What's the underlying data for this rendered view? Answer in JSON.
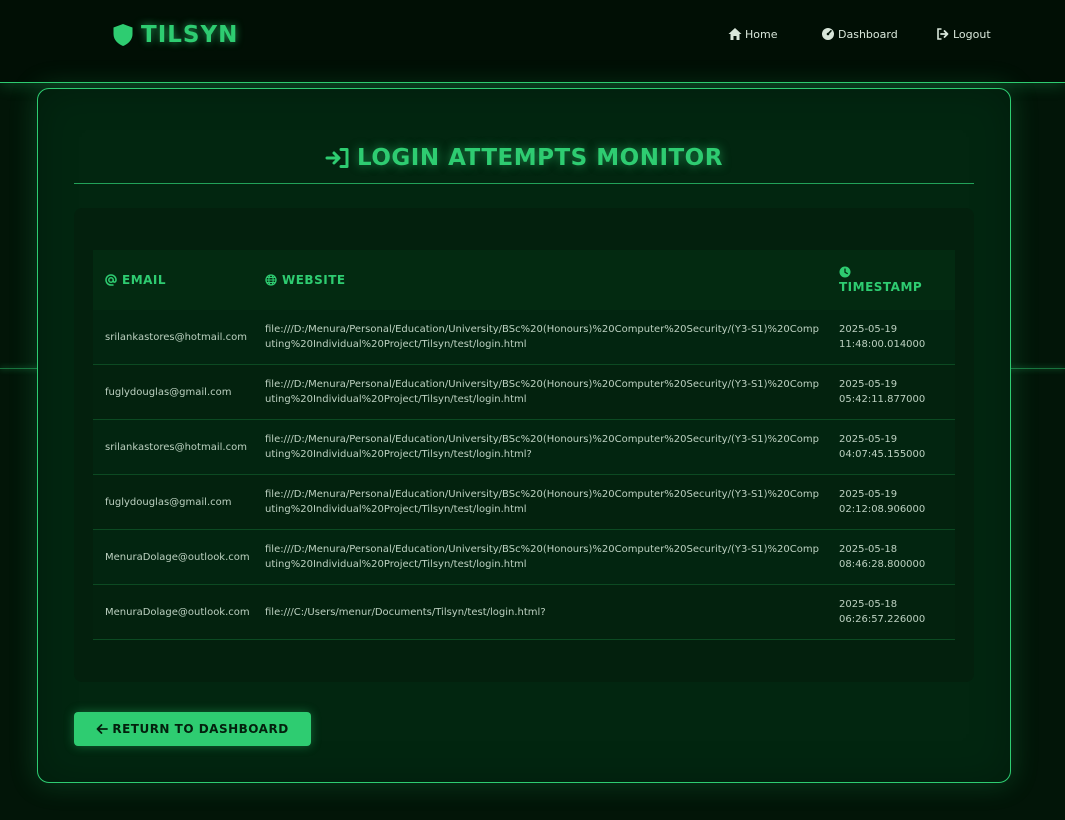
{
  "brand": {
    "name": "TILSYN",
    "icon": "shield-icon"
  },
  "nav": [
    {
      "label": "Home",
      "icon": "home-icon"
    },
    {
      "label": "Dashboard",
      "icon": "dashboard-gauge-icon"
    },
    {
      "label": "Logout",
      "icon": "logout-icon"
    }
  ],
  "page": {
    "title": "LOGIN ATTEMPTS MONITOR",
    "title_icon": "sign-in-icon"
  },
  "table": {
    "headers": {
      "email": "EMAIL",
      "website": "WEBSITE",
      "timestamp": "TIMESTAMP"
    },
    "rows": [
      {
        "email": "srilankastores@hotmail.com",
        "website": "file:///D:/Menura/Personal/Education/University/BSc%20(Honours)%20Computer%20Security/(Y3-S1)%20Computing%20Individual%20Project/Tilsyn/test/login.html",
        "date": "2025-05-19",
        "time": "11:48:00.014000"
      },
      {
        "email": "fuglydouglas@gmail.com",
        "website": "file:///D:/Menura/Personal/Education/University/BSc%20(Honours)%20Computer%20Security/(Y3-S1)%20Computing%20Individual%20Project/Tilsyn/test/login.html",
        "date": "2025-05-19",
        "time": "05:42:11.877000"
      },
      {
        "email": "srilankastores@hotmail.com",
        "website": "file:///D:/Menura/Personal/Education/University/BSc%20(Honours)%20Computer%20Security/(Y3-S1)%20Computing%20Individual%20Project/Tilsyn/test/login.html?",
        "date": "2025-05-19",
        "time": "04:07:45.155000"
      },
      {
        "email": "fuglydouglas@gmail.com",
        "website": "file:///D:/Menura/Personal/Education/University/BSc%20(Honours)%20Computer%20Security/(Y3-S1)%20Computing%20Individual%20Project/Tilsyn/test/login.html",
        "date": "2025-05-19",
        "time": "02:12:08.906000"
      },
      {
        "email": "MenuraDolage@outlook.com",
        "website": "file:///D:/Menura/Personal/Education/University/BSc%20(Honours)%20Computer%20Security/(Y3-S1)%20Computing%20Individual%20Project/Tilsyn/test/login.html",
        "date": "2025-05-18",
        "time": "08:46:28.800000"
      },
      {
        "email": "MenuraDolage@outlook.com",
        "website": "file:///C:/Users/menur/Documents/Tilsyn/test/login.html?",
        "date": "2025-05-18",
        "time": "06:26:57.226000"
      }
    ]
  },
  "actions": {
    "return_label": "RETURN TO DASHBOARD",
    "return_icon": "arrow-left-icon"
  },
  "colors": {
    "accent": "#2ecc71",
    "background": "#021508",
    "panel": "#022610",
    "text": "#bcd0c0"
  }
}
